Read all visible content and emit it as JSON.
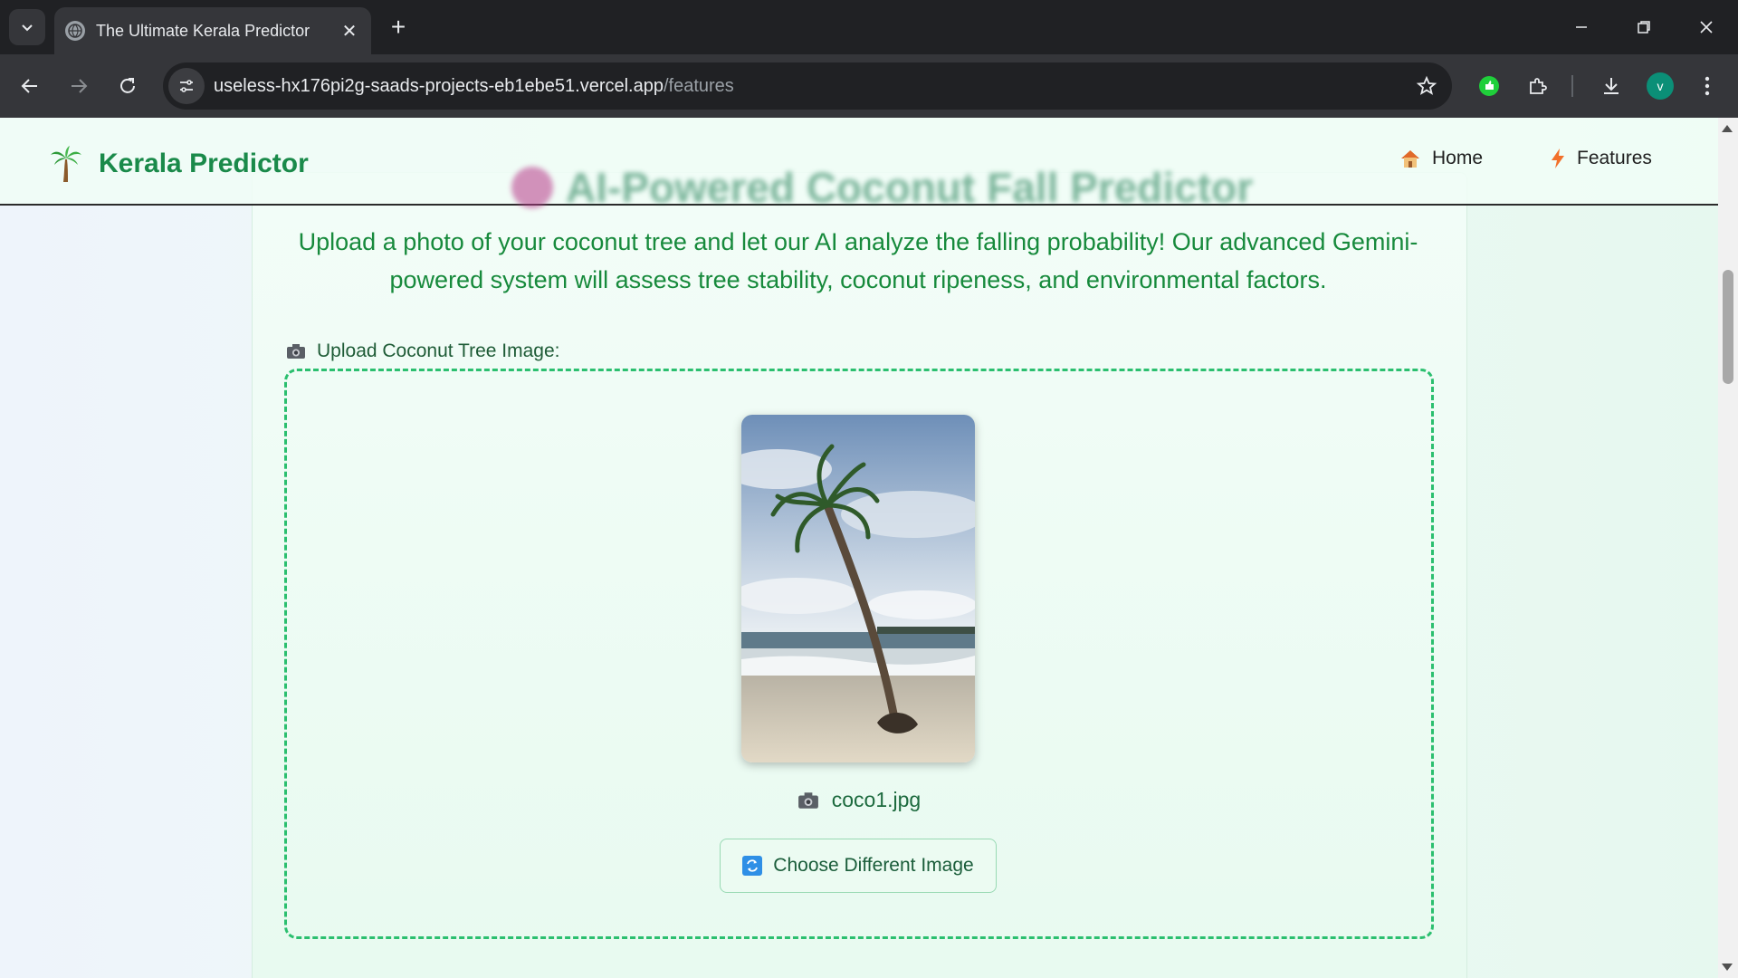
{
  "browser": {
    "tab_title": "The Ultimate Kerala Predictor",
    "url_domain": "useless-hx176pi2g-saads-projects-eb1ebe51.vercel.app",
    "url_path": "/features",
    "profile_initial": "v"
  },
  "nav": {
    "brand": "Kerala Predictor",
    "links": [
      {
        "label": "Home",
        "icon": "house-icon"
      },
      {
        "label": "Features",
        "icon": "lightning-icon"
      }
    ]
  },
  "hero": {
    "title": "AI-Powered Coconut Fall Predictor"
  },
  "intro_text": "Upload a photo of your coconut tree and let our AI analyze the falling probability! Our advanced Gemini-powered system will assess tree stability, coconut ripeness, and environmental factors.",
  "upload": {
    "label": "Upload Coconut Tree Image:",
    "file_name": "coco1.jpg",
    "change_button": "Choose Different Image"
  },
  "colors": {
    "brand_green": "#1a8a4a",
    "text_green": "#178a3c",
    "dropzone_border": "#2bbf6f",
    "chrome_dark": "#202124",
    "chrome_toolbar": "#35363a"
  }
}
